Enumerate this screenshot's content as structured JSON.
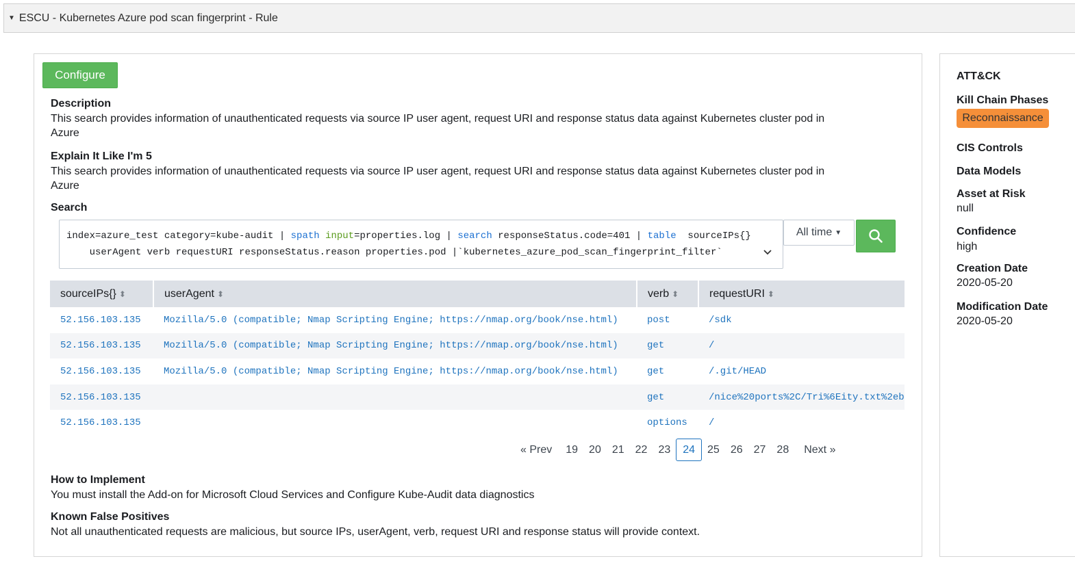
{
  "header": {
    "title": "ESCU - Kubernetes Azure pod scan fingerprint - Rule"
  },
  "main": {
    "configure_label": "Configure",
    "description": {
      "title": "Description",
      "line1": "This search provides information of unauthenticated requests via source IP user agent, request URI and response status data against Kubernetes cluster pod in",
      "line2": "Azure"
    },
    "eli5": {
      "title": "Explain It Like I'm 5",
      "line1": "This search provides information of unauthenticated requests via source IP user agent, request URI and response status data against Kubernetes cluster pod in",
      "line2": "Azure"
    },
    "search": {
      "title": "Search",
      "q1_a": "index=azure_test category=kube-audit | ",
      "q1_spath": "spath",
      "q1_b": " ",
      "q1_input": "input",
      "q1_c": "=properties.log | ",
      "q1_search": "search",
      "q1_d": " responseStatus.code=401 | ",
      "q1_table": "table",
      "q1_e": "  sourceIPs{}",
      "q2": "    userAgent verb requestURI responseStatus.reason properties.pod |`kubernetes_azure_pod_scan_fingerprint_filter`",
      "time_range": "All time"
    },
    "table": {
      "columns": [
        "sourceIPs{}",
        "userAgent",
        "verb",
        "requestURI"
      ],
      "rows": [
        [
          "52.156.103.135",
          "Mozilla/5.0 (compatible; Nmap Scripting Engine; https://nmap.org/book/nse.html)",
          "post",
          "/sdk"
        ],
        [
          "52.156.103.135",
          "Mozilla/5.0 (compatible; Nmap Scripting Engine; https://nmap.org/book/nse.html)",
          "get",
          "/"
        ],
        [
          "52.156.103.135",
          "Mozilla/5.0 (compatible; Nmap Scripting Engine; https://nmap.org/book/nse.html)",
          "get",
          "/.git/HEAD"
        ],
        [
          "52.156.103.135",
          "",
          "get",
          "/nice%20ports%2C/Tri%6Eity.txt%2eb"
        ],
        [
          "52.156.103.135",
          "",
          "options",
          "/"
        ]
      ]
    },
    "pagination": {
      "prev": "« Prev",
      "pages": [
        "19",
        "20",
        "21",
        "22",
        "23",
        "24",
        "25",
        "26",
        "27",
        "28"
      ],
      "active": "24",
      "next": "Next »"
    },
    "how_to_implement": {
      "title": "How to Implement",
      "text": "You must install the Add-on for Microsoft Cloud Services and Configure Kube-Audit data diagnostics"
    },
    "known_false_positives": {
      "title": "Known False Positives",
      "text": "Not all unauthenticated requests are malicious, but source IPs, userAgent, verb, request URI and response status will provide context."
    }
  },
  "side": {
    "attack_title": "ATT&CK",
    "kill_chain_title": "Kill Chain Phases",
    "kill_chain_badge": "Reconnaissance",
    "cis_title": "CIS Controls",
    "data_models_title": "Data Models",
    "asset_title": "Asset at Risk",
    "asset_value": "null",
    "confidence_title": "Confidence",
    "confidence_value": "high",
    "creation_title": "Creation Date",
    "creation_value": "2020-05-20",
    "modification_title": "Modification Date",
    "modification_value": "2020-05-20"
  },
  "colors": {
    "accent_green": "#5cb85c",
    "link_blue": "#1e73be",
    "badge_orange": "#f58f39",
    "header_gray": "#dce0e6"
  }
}
